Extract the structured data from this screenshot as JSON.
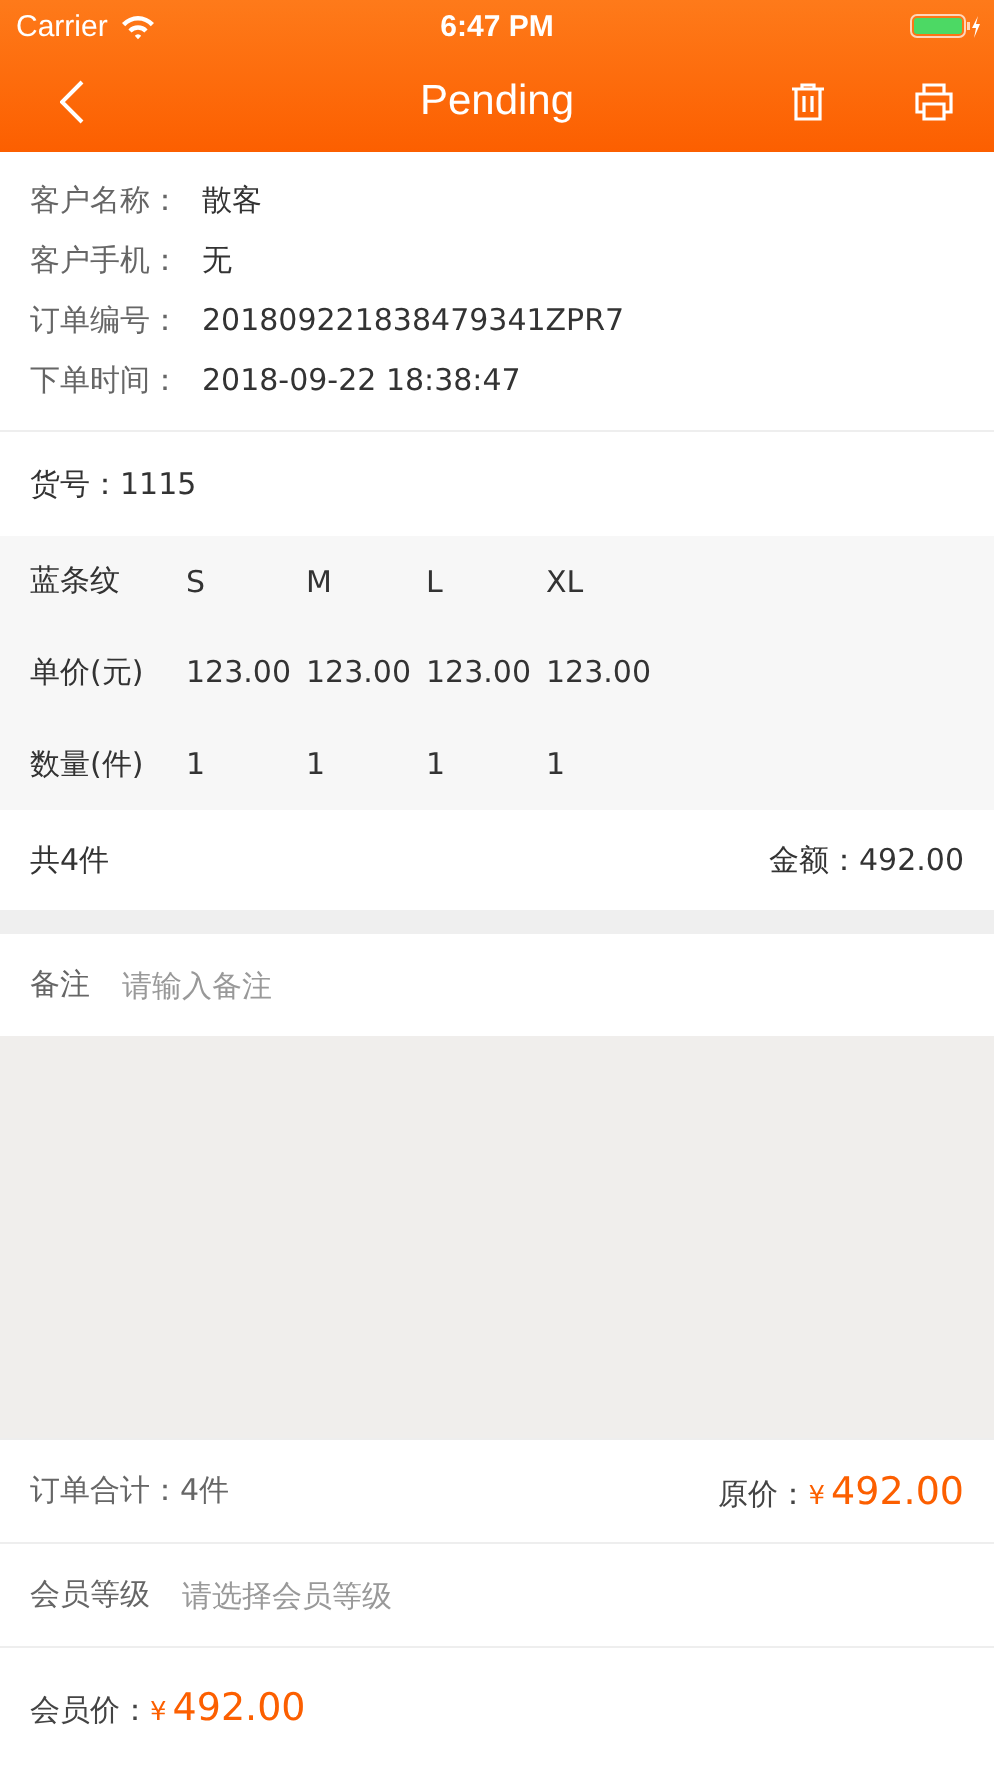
{
  "status_bar": {
    "carrier": "Carrier",
    "time": "6:47 PM"
  },
  "nav": {
    "title": "Pending"
  },
  "customer_info": [
    {
      "label": "客户名称：",
      "value": "散客"
    },
    {
      "label": "客户手机：",
      "value": "无"
    },
    {
      "label": "订单编号：",
      "value": "201809221838479341ZPR7"
    },
    {
      "label": "下单时间：",
      "value": "2018-09-22 18:38:47"
    }
  ],
  "item_no": {
    "label": "货号：",
    "value": "1115"
  },
  "size_table": {
    "rows": [
      {
        "label": "蓝条纹",
        "cells": [
          "S",
          "M",
          "L",
          "XL"
        ]
      },
      {
        "label": "单价(元)",
        "cells": [
          "123.00",
          "123.00",
          "123.00",
          "123.00"
        ]
      },
      {
        "label": "数量(件)",
        "cells": [
          "1",
          "1",
          "1",
          "1"
        ]
      }
    ]
  },
  "item_total": {
    "count": "共4件",
    "amount_label": "金额：",
    "amount": "492.00"
  },
  "remark": {
    "label": "备注",
    "placeholder": "请输入备注"
  },
  "order_total": {
    "label": "订单合计：4件",
    "price_label": "原价：",
    "currency": "¥",
    "price": "492.00"
  },
  "member_level": {
    "label": "会员等级",
    "placeholder": "请选择会员等级"
  },
  "member_price": {
    "label": "会员价：",
    "currency": "¥",
    "price": "492.00"
  }
}
